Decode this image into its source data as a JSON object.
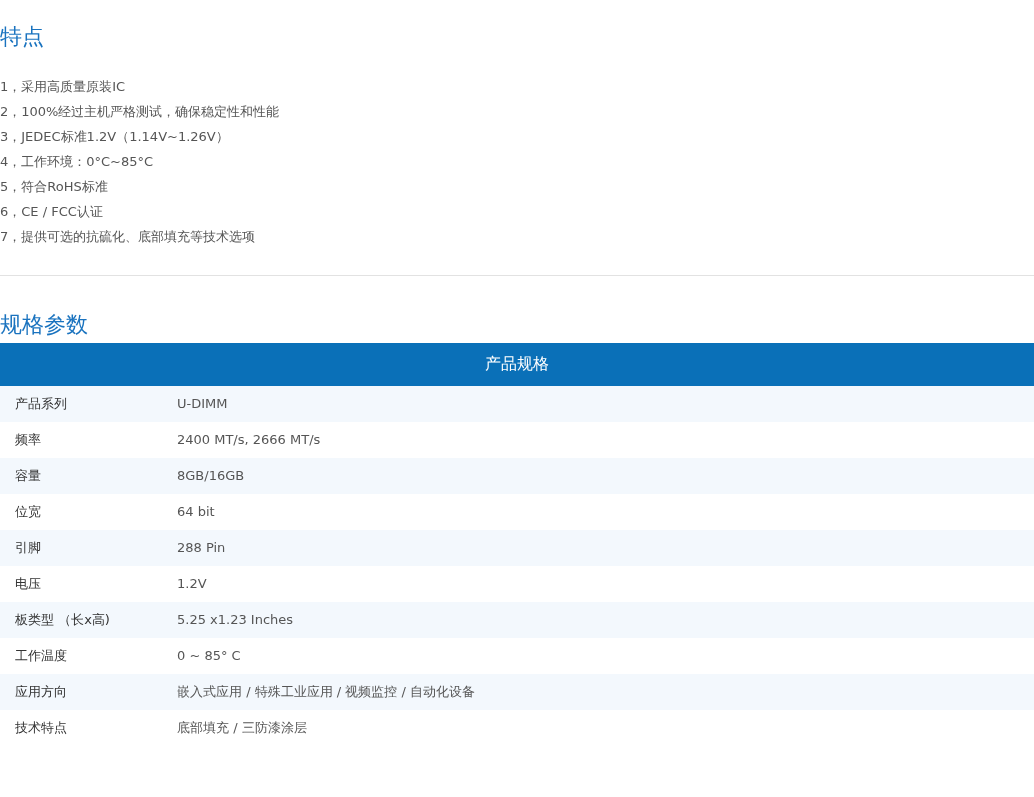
{
  "features": {
    "title": "特点",
    "items": [
      "1，采用高质量原装IC",
      "2，100%经过主机严格测试，确保稳定性和性能",
      "3，JEDEC标准1.2V（1.14V~1.26V）",
      "4，工作环境：0°C~85°C",
      "5，符合RoHS标准",
      "6，CE / FCC认证",
      "7，提供可选的抗硫化、底部填充等技术选项"
    ]
  },
  "specs": {
    "title": "规格参数",
    "table_title": "产品规格",
    "rows": [
      {
        "label": "产品系列",
        "value": "U-DIMM"
      },
      {
        "label": "频率",
        "value": "2400 MT/s, 2666 MT/s"
      },
      {
        "label": "容量",
        "value": "8GB/16GB"
      },
      {
        "label": "位宽",
        "value": "64 bit"
      },
      {
        "label": "引脚",
        "value": "288 Pin"
      },
      {
        "label": "电压",
        "value": "1.2V"
      },
      {
        "label": "板类型 （长x高)",
        "value": "5.25 x1.23 Inches"
      },
      {
        "label": "工作温度",
        "value": "0 ~ 85° C"
      },
      {
        "label": "应用方向",
        "value": "嵌入式应用 / 特殊工业应用 / 视频监控 / 自动化设备"
      },
      {
        "label": "技术特点",
        "value": "底部填充 / 三防漆涂层"
      }
    ]
  }
}
